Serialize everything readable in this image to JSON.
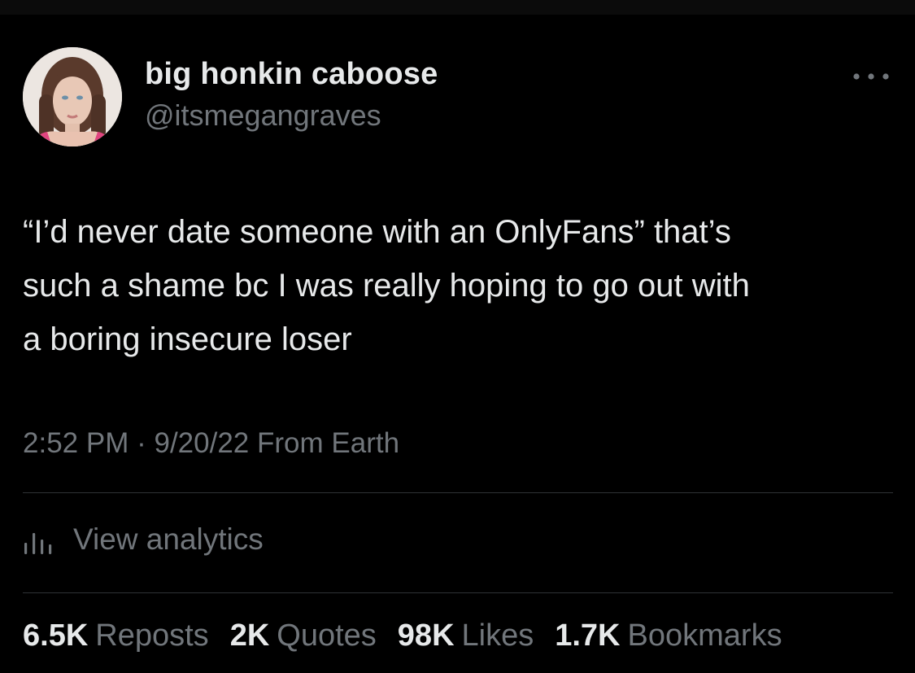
{
  "tweet": {
    "author": {
      "display_name": "big honkin caboose",
      "handle": "@itsmegangraves"
    },
    "text": "“I’d never date someone with an OnlyFans” that’s\nsuch a shame bc I was really hoping to go out with\na boring insecure loser",
    "time": "2:52 PM",
    "separator": "·",
    "date": "9/20/22",
    "source": "From Earth",
    "analytics_label": "View analytics",
    "stats": [
      {
        "count": "6.5K",
        "label": "Reposts"
      },
      {
        "count": "2K",
        "label": "Quotes"
      },
      {
        "count": "98K",
        "label": "Likes"
      },
      {
        "count": "1.7K",
        "label": "Bookmarks"
      }
    ]
  },
  "icons": {
    "more": "more-dots-icon",
    "analytics": "analytics-bars-icon"
  },
  "colors": {
    "background": "#000000",
    "primary_text": "#e7e9ea",
    "secondary_text": "#71767b",
    "divider": "#2f3336"
  }
}
